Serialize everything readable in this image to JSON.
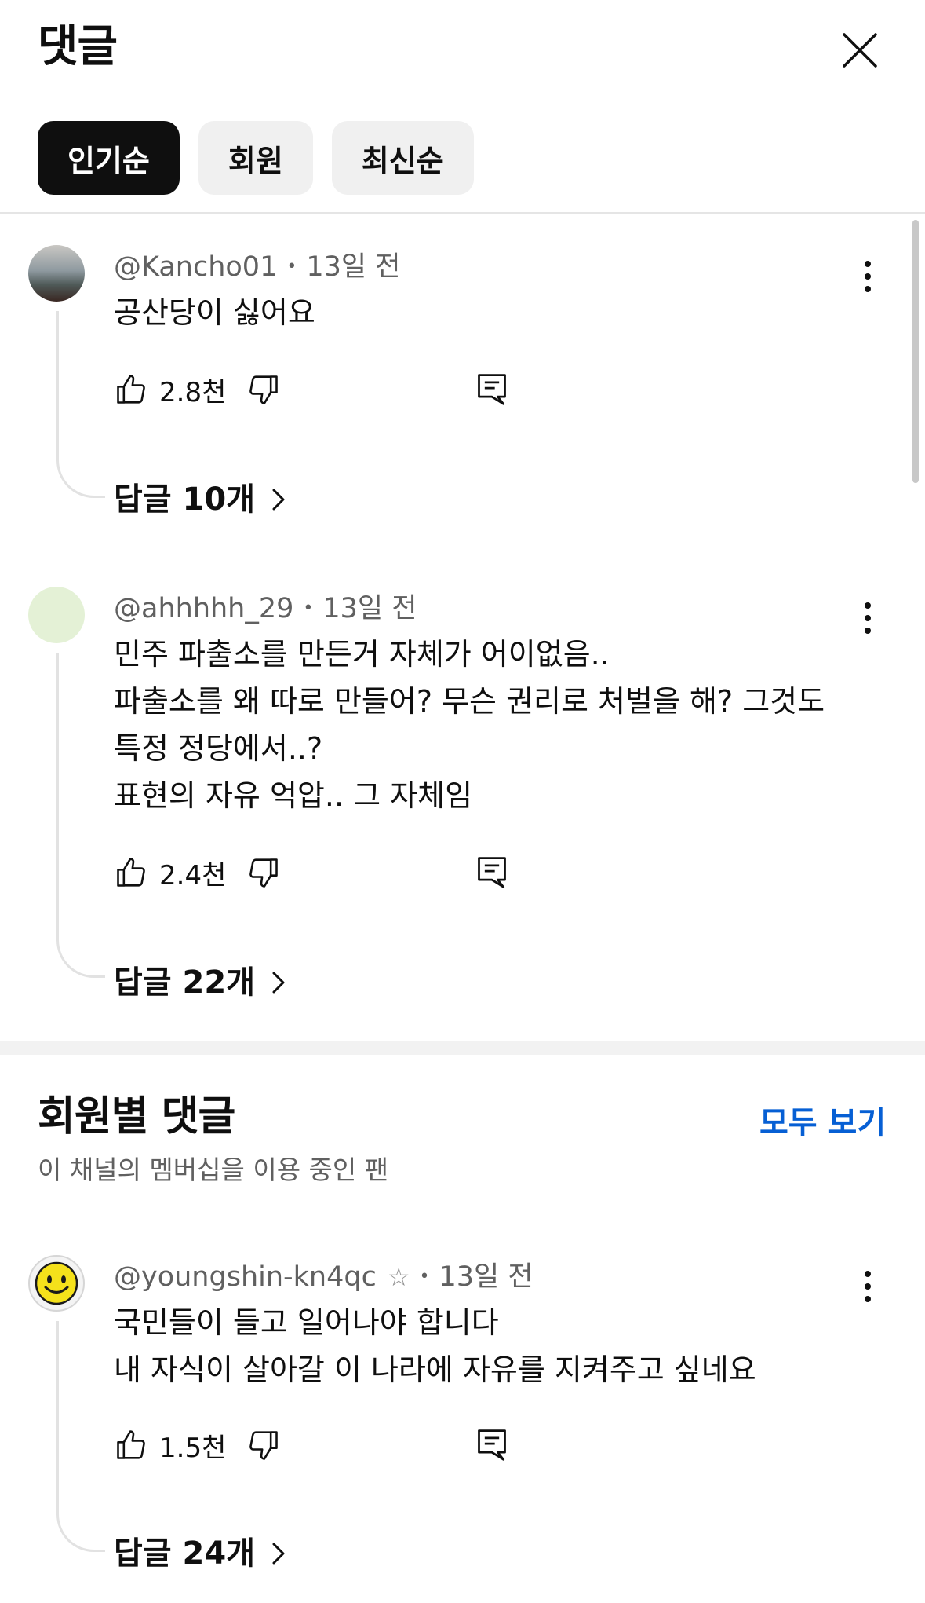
{
  "header": {
    "title": "댓글",
    "close_icon": "close-icon"
  },
  "sort_chips": [
    {
      "label": "인기순",
      "active": true
    },
    {
      "label": "회원",
      "active": false
    },
    {
      "label": "최신순",
      "active": false
    }
  ],
  "comments": [
    {
      "author": "@Kancho01",
      "time": "13일 전",
      "lines": [
        "공산당이 싫어요"
      ],
      "likes": "2.8천",
      "replies": "답글 10개"
    },
    {
      "author": "@ahhhhh_29",
      "time": "13일 전",
      "lines": [
        "민주 파출소를 만든거 자체가 어이없음..",
        "파출소를 왜 따로 만들어? 무슨 권리로 처벌을 해? 그것도",
        "특정 정당에서..?",
        "표현의 자유 억압.. 그 자체임"
      ],
      "likes": "2.4천",
      "replies": "답글 22개"
    }
  ],
  "member_section": {
    "title": "회원별 댓글",
    "subtitle": "이 채널의 멤버십을 이용 중인 팬",
    "see_all": "모두 보기",
    "comment": {
      "author": "@youngshin-kn4qc",
      "time": "13일 전",
      "lines": [
        "국민들이 들고 일어나야 합니다",
        "내 자식이 살아갈 이 나라에 자유를 지켜주고 싶네요"
      ],
      "likes": "1.5천",
      "replies": "답글 24개"
    }
  },
  "colors": {
    "accent": "#065fd4",
    "chip_active": "#0f0f0f",
    "chip_inactive": "#f0f0f0"
  }
}
